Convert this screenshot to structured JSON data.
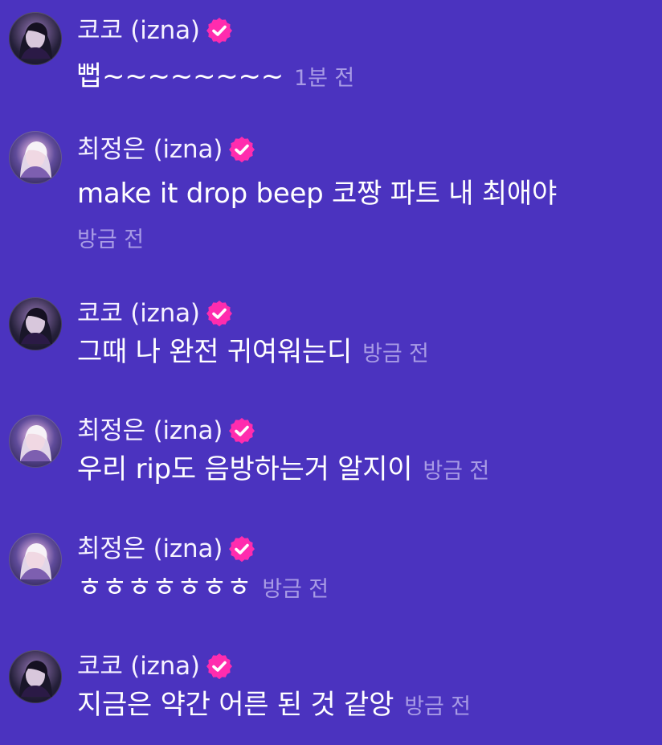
{
  "messages": [
    {
      "name": "코코 (izna)",
      "text": "뻡~~~~~~~~",
      "time": "1분 전",
      "avatar": "avatar-dark-hair"
    },
    {
      "name": "최정은 (izna)",
      "text": "make it drop beep 코짱 파트 내 최애야",
      "time": "방금 전",
      "avatar": "avatar-blonde-hair"
    },
    {
      "name": "코코 (izna)",
      "text": "그때 나 완전 귀여워는디",
      "time": "방금 전",
      "avatar": "avatar-dark-hair"
    },
    {
      "name": "최정은 (izna)",
      "text": "우리 rip도 음방하는거 알지이",
      "time": "방금 전",
      "avatar": "avatar-blonde-hair"
    },
    {
      "name": "최정은 (izna)",
      "text": "ㅎㅎㅎㅎㅎㅎㅎ",
      "time": "방금 전",
      "avatar": "avatar-blonde-hair"
    },
    {
      "name": "코코 (izna)",
      "text": "지금은 약간 어른 된 것 같앙",
      "time": "방금 전",
      "avatar": "avatar-dark-hair"
    }
  ],
  "icons": {
    "verified": "verified-badge-icon"
  },
  "colors": {
    "background": "#4b33bf",
    "text": "#ffffff",
    "timestamp": "#a89be5",
    "badge_outer": "#ff2cae",
    "badge_inner": "#ffffff"
  }
}
